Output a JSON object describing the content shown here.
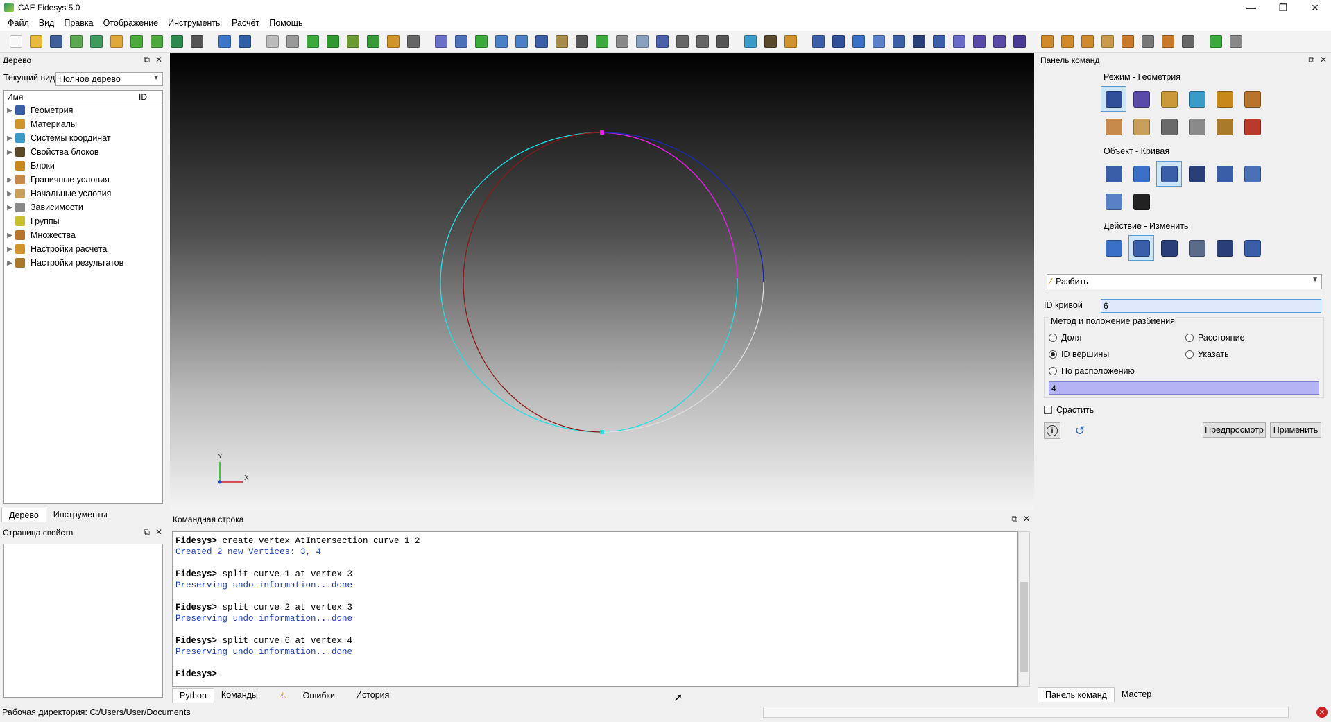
{
  "window": {
    "title": "CAE Fidesys 5.0",
    "controls": [
      "—",
      "❐",
      "✕"
    ]
  },
  "menu": [
    "Файл",
    "Вид",
    "Правка",
    "Отображение",
    "Инструменты",
    "Расчёт",
    "Помощь"
  ],
  "toolbar_icons": [
    {
      "name": "new-file-icon",
      "color": "#f8f8f8"
    },
    {
      "name": "open-folder-icon",
      "color": "#e8b93a"
    },
    {
      "name": "save-icon",
      "color": "#3f5f9a"
    },
    {
      "name": "save-as-icon",
      "color": "#5aa84f"
    },
    {
      "name": "export-icon",
      "color": "#3f9a5e"
    },
    {
      "name": "journal-icon",
      "color": "#e0a83a"
    },
    {
      "name": "play-script-icon",
      "color": "#4caa3c"
    },
    {
      "name": "id-icon",
      "color": "#4caa3c"
    },
    {
      "name": "spectrum-icon",
      "color": "#2d8a4e"
    },
    {
      "name": "tools-icon",
      "color": "#555"
    },
    {
      "name": "select-icon",
      "color": "#3a77c8"
    },
    {
      "name": "undo-icon",
      "color": "#2f5fa8"
    },
    {
      "name": "wire-box-icon",
      "color": "#bbb"
    },
    {
      "name": "hidden-box-icon",
      "color": "#999"
    },
    {
      "name": "shaded-box-icon",
      "color": "#3aaa3a"
    },
    {
      "name": "smooth-box-icon",
      "color": "#2e9a2e"
    },
    {
      "name": "geometry-icon",
      "color": "#6a9a30"
    },
    {
      "name": "mesh-box-icon",
      "color": "#3a9a3a"
    },
    {
      "name": "materials-icon",
      "color": "#d0942a"
    },
    {
      "name": "grid-icon",
      "color": "#666"
    },
    {
      "name": "cube-icon",
      "color": "#6a70c8"
    },
    {
      "name": "window-icon",
      "color": "#4a70b8"
    },
    {
      "name": "refresh-icon",
      "color": "#3aaa3a"
    },
    {
      "name": "zoom-in-icon",
      "color": "#4a80c8"
    },
    {
      "name": "zoom-out-icon",
      "color": "#4a80c8"
    },
    {
      "name": "pan-icon",
      "color": "#3a5fa8"
    },
    {
      "name": "perspective-icon",
      "color": "#a88a4a"
    },
    {
      "name": "view-front-icon",
      "color": "#555"
    },
    {
      "name": "view-back-icon",
      "color": "#3aaa3a"
    },
    {
      "name": "view-top-icon",
      "color": "#888"
    },
    {
      "name": "view-iso-icon",
      "color": "#8aa0c0"
    },
    {
      "name": "view-bottom-icon",
      "color": "#4a60a8"
    },
    {
      "name": "view-left-icon",
      "color": "#666"
    },
    {
      "name": "view-right-icon",
      "color": "#666"
    },
    {
      "name": "view-fit-icon",
      "color": "#555"
    },
    {
      "name": "axis-icon",
      "color": "#3a9ac8"
    },
    {
      "name": "measure-icon",
      "color": "#5a4a2a"
    },
    {
      "name": "eraser-icon",
      "color": "#d0942a"
    },
    {
      "name": "volumes-icon",
      "color": "#3a5fa8"
    },
    {
      "name": "surfaces-icon",
      "color": "#2f4f98"
    },
    {
      "name": "body-icon",
      "color": "#3a6fc8"
    },
    {
      "name": "face-icon",
      "color": "#5a80c8"
    },
    {
      "name": "curve-icon",
      "color": "#3a5fa8"
    },
    {
      "name": "vertex-icon",
      "color": "#2a3f78"
    },
    {
      "name": "node-icon",
      "color": "#3a5fa8"
    },
    {
      "name": "edge-icon",
      "color": "#6a6ac8"
    },
    {
      "name": "quad-icon",
      "color": "#5a4aa8"
    },
    {
      "name": "hex-icon",
      "color": "#5a4aa8"
    },
    {
      "name": "tet-icon",
      "color": "#4a3a98"
    },
    {
      "name": "load-icon",
      "color": "#d08a2a"
    },
    {
      "name": "constraint-icon",
      "color": "#d08a2a"
    },
    {
      "name": "force-icon",
      "color": "#d08a2a"
    },
    {
      "name": "pressure-icon",
      "color": "#c89a4a"
    },
    {
      "name": "temperature-icon",
      "color": "#c87a2a"
    },
    {
      "name": "contact-icon",
      "color": "#777"
    },
    {
      "name": "text-icon",
      "color": "#c87a2a"
    },
    {
      "name": "layout-icon",
      "color": "#666"
    },
    {
      "name": "run-icon",
      "color": "#3aaa3a"
    },
    {
      "name": "probe-icon",
      "color": "#888"
    }
  ],
  "tree_dock": {
    "title": "Дерево",
    "current_view_label": "Текущий вид",
    "current_view_value": "Полное дерево",
    "col_name": "Имя",
    "col_id": "ID",
    "items": [
      {
        "label": "Геометрия",
        "icon": "geometry-icon",
        "color": "#3a5fa8",
        "expandable": true
      },
      {
        "label": "Материалы",
        "icon": "materials-icon",
        "color": "#d0942a",
        "expandable": false
      },
      {
        "label": "Системы координат",
        "icon": "coordinate-systems-icon",
        "color": "#3a9ac8",
        "expandable": true
      },
      {
        "label": "Свойства блоков",
        "icon": "block-properties-icon",
        "color": "#5a4a2a",
        "expandable": true
      },
      {
        "label": "Блоки",
        "icon": "blocks-icon",
        "color": "#c8881a",
        "expandable": false
      },
      {
        "label": "Граничные условия",
        "icon": "boundary-conditions-icon",
        "color": "#c88a4a",
        "expandable": true
      },
      {
        "label": "Начальные условия",
        "icon": "initial-conditions-icon",
        "color": "#c8a05a",
        "expandable": true
      },
      {
        "label": "Зависимости",
        "icon": "dependencies-icon",
        "color": "#8a8a8a",
        "expandable": true
      },
      {
        "label": "Группы",
        "icon": "groups-icon",
        "color": "#c8c030",
        "expandable": false
      },
      {
        "label": "Множества",
        "icon": "sets-icon",
        "color": "#b8742a",
        "expandable": true
      },
      {
        "label": "Настройки расчета",
        "icon": "calc-settings-icon",
        "color": "#d0942a",
        "expandable": true
      },
      {
        "label": "Настройки результатов",
        "icon": "results-settings-icon",
        "color": "#a87a2a",
        "expandable": true
      }
    ],
    "tabs": [
      "Дерево",
      "Инструменты"
    ]
  },
  "properties_dock": {
    "title": "Страница свойств"
  },
  "viewport": {
    "axis_x": "X",
    "axis_y": "Y",
    "colors": {
      "cyan": "#20e0e0",
      "darkred": "#8a1a1a",
      "magenta": "#e020e0",
      "blue": "#1a2aa8",
      "white": "#d8d8d8"
    }
  },
  "command_dock": {
    "title": "Командная строка",
    "lines": [
      {
        "kind": "prompt",
        "text": "Fidesys> create vertex AtIntersection curve 1 2"
      },
      {
        "kind": "resp",
        "text": "Created 2 new Vertices: 3, 4"
      },
      {
        "kind": "gap",
        "text": ""
      },
      {
        "kind": "prompt",
        "text": "Fidesys> split curve 1 at vertex 3"
      },
      {
        "kind": "resp",
        "text": "Preserving undo information...done"
      },
      {
        "kind": "gap",
        "text": ""
      },
      {
        "kind": "prompt",
        "text": "Fidesys> split curve 2 at vertex 3"
      },
      {
        "kind": "resp",
        "text": "Preserving undo information...done"
      },
      {
        "kind": "gap",
        "text": ""
      },
      {
        "kind": "prompt",
        "text": "Fidesys> split curve 6 at vertex 4"
      },
      {
        "kind": "resp",
        "text": "Preserving undo information...done"
      },
      {
        "kind": "gap",
        "text": ""
      },
      {
        "kind": "prompt",
        "text": "Fidesys>"
      }
    ],
    "tabs": [
      "Python",
      "Команды",
      "Ошибки",
      "История"
    ]
  },
  "command_panel": {
    "title": "Панель команд",
    "mode_label": "Режим - Геометрия",
    "mode_icons": [
      {
        "name": "geometry-mode-icon",
        "color": "#2f4f98",
        "selected": true
      },
      {
        "name": "mesh-mode-icon",
        "color": "#5a4aa8"
      },
      {
        "name": "material-mode-icon",
        "color": "#c89a3a"
      },
      {
        "name": "coordinate-mode-icon",
        "color": "#3a9ac8"
      },
      {
        "name": "blocks-mode-icon",
        "color": "#c8881a"
      },
      {
        "name": "sets-mode-icon",
        "color": "#b8742a"
      },
      {
        "name": "bc-mode-icon",
        "color": "#c88a4a"
      },
      {
        "name": "initial-mode-icon",
        "color": "#c8a05a"
      },
      {
        "name": "dependency-mode-icon",
        "color": "#6a6a6a"
      },
      {
        "name": "table-mode-icon",
        "color": "#8a8a8a"
      },
      {
        "name": "results-mode-icon",
        "color": "#a87a2a"
      },
      {
        "name": "analysis-mode-icon",
        "color": "#b83a2a"
      }
    ],
    "object_label": "Объект - Кривая",
    "object_icons": [
      {
        "name": "volume-object-icon",
        "color": "#3a5fa8"
      },
      {
        "name": "surface-object-icon",
        "color": "#3a6fc8"
      },
      {
        "name": "curve-object-icon",
        "color": "#3a5fa8",
        "selected": true
      },
      {
        "name": "vertex-object-icon",
        "color": "#2a3f78"
      },
      {
        "name": "group-object-icon",
        "color": "#3a5fa8"
      },
      {
        "name": "body-object-icon",
        "color": "#4a70b8"
      },
      {
        "name": "measure-object-icon",
        "color": "#5a80c8"
      },
      {
        "name": "text-object-icon",
        "color": "#222"
      }
    ],
    "action_label": "Действие - Изменить",
    "action_icons": [
      {
        "name": "create-action-icon",
        "color": "#3a6fc8"
      },
      {
        "name": "modify-action-icon",
        "color": "#3a5fa8",
        "selected": true
      },
      {
        "name": "transform-action-icon",
        "color": "#2a3f78"
      },
      {
        "name": "settings-action-icon",
        "color": "#5a6a88"
      },
      {
        "name": "delete-action-icon",
        "color": "#2a3f78"
      },
      {
        "name": "boolean-action-icon",
        "color": "#3a5fa8"
      }
    ],
    "operation": "Разбить",
    "curve_id_label": "ID кривой",
    "curve_id_value": "6",
    "method_group_label": "Метод и положение разбиения",
    "radio": [
      {
        "label": "Доля",
        "checked": false
      },
      {
        "label": "Расстояние",
        "checked": false
      },
      {
        "label": "ID вершины",
        "checked": true
      },
      {
        "label": "Указать",
        "checked": false
      },
      {
        "label": "По расположению",
        "checked": false
      }
    ],
    "vertex_value": "4",
    "merge_label": "Срастить",
    "preview_button": "Предпросмотр",
    "apply_button": "Применить",
    "bottom_tabs": [
      "Панель команд",
      "Мастер"
    ]
  },
  "status": {
    "workdir": "Рабочая директория: C:/Users/User/Documents"
  }
}
